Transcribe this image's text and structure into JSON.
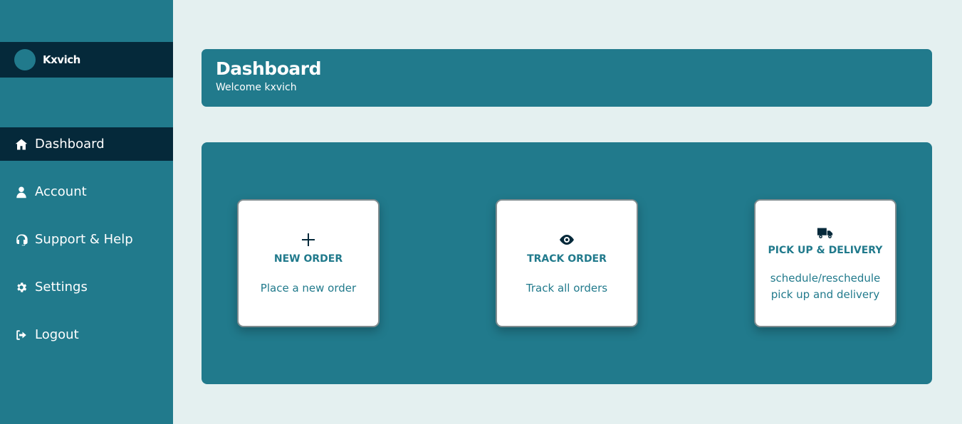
{
  "user": {
    "name": "Kxvich"
  },
  "sidebar": {
    "items": [
      {
        "label": "Dashboard",
        "icon": "home-icon",
        "active": true
      },
      {
        "label": "Account",
        "icon": "user-icon"
      },
      {
        "label": "Support & Help",
        "icon": "headset-icon"
      },
      {
        "label": "Settings",
        "icon": "gear-icon"
      },
      {
        "label": "Logout",
        "icon": "logout-icon"
      }
    ]
  },
  "header": {
    "title": "Dashboard",
    "subtitle": "Welcome kxvich"
  },
  "cards": [
    {
      "icon": "plus-icon",
      "title": "NEW ORDER",
      "description": "Place a new order"
    },
    {
      "icon": "eye-icon",
      "title": "TRACK ORDER",
      "description": "Track all orders"
    },
    {
      "icon": "truck-icon",
      "title": "PICK UP & DELIVERY",
      "description": "schedule/reschedule pick up and delivery"
    }
  ],
  "colors": {
    "primary": "#217a8c",
    "dark": "#05293a",
    "background": "#e4f0f0",
    "card": "#ffffff"
  }
}
